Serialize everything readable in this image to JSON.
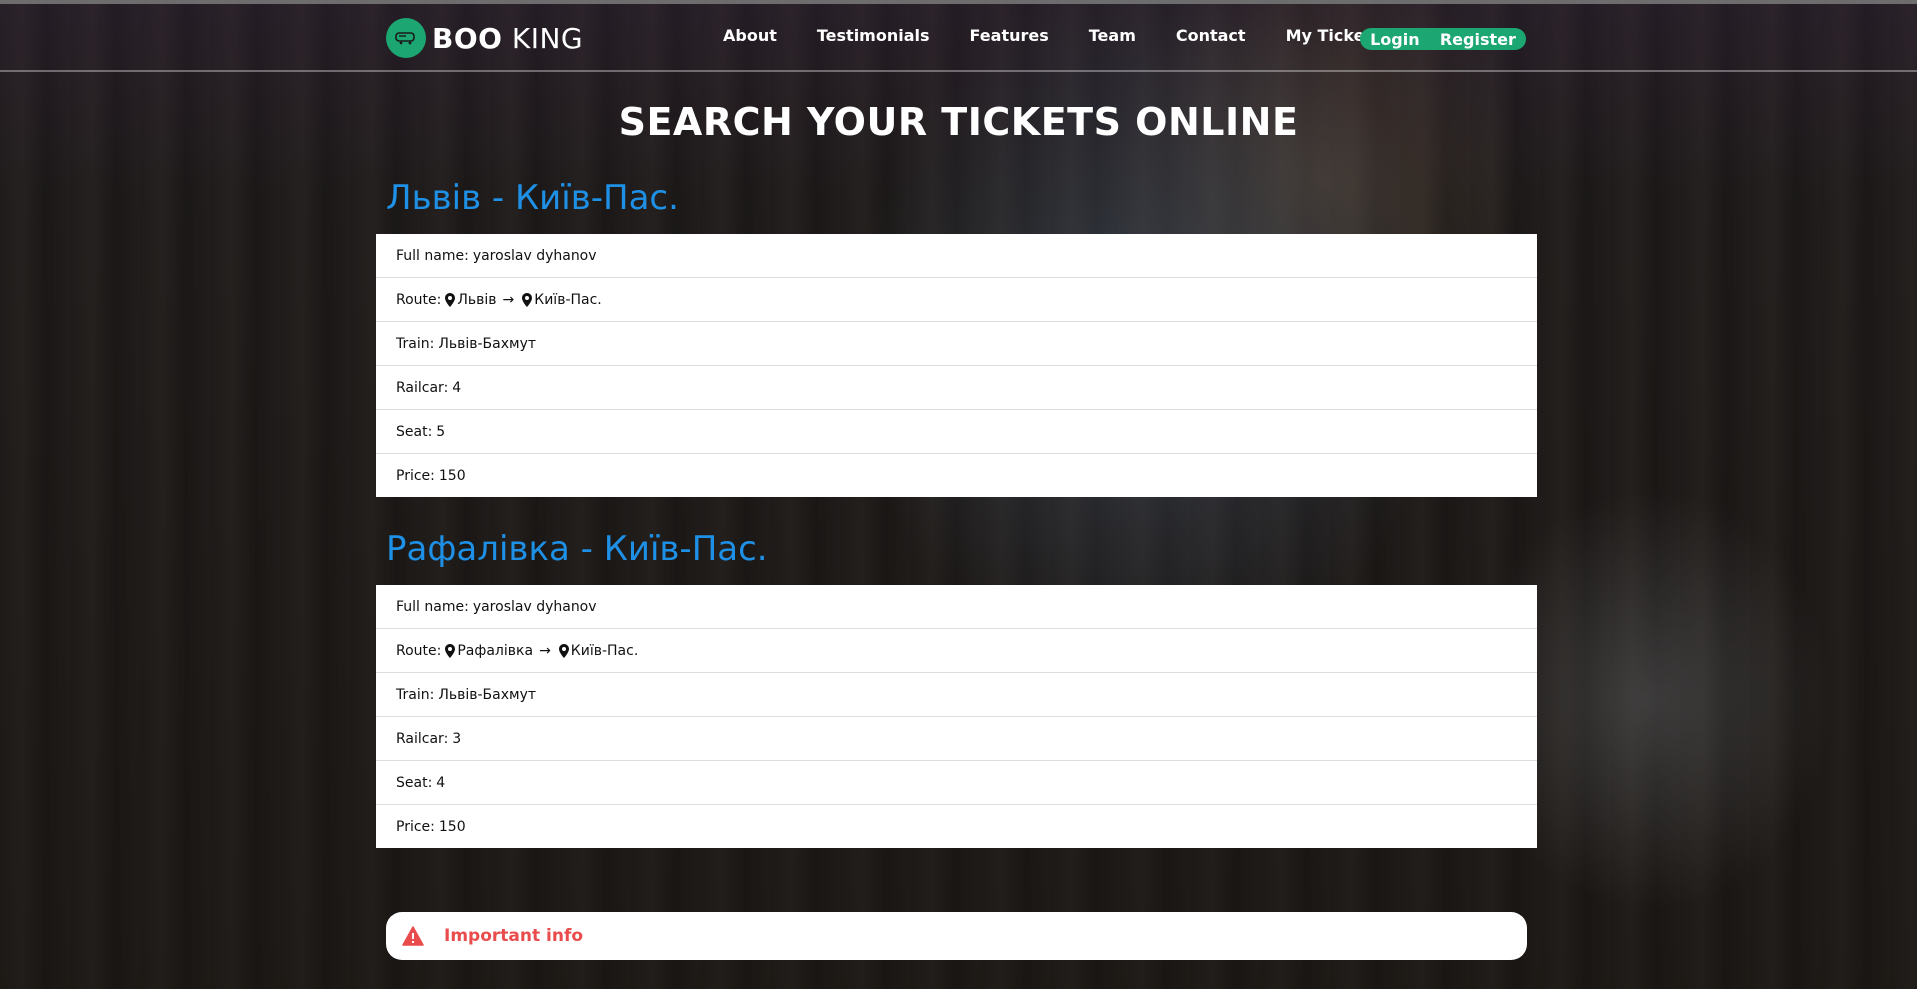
{
  "brand": {
    "bold": "BOO",
    "light": "KING",
    "accent": "#1ba672"
  },
  "nav": {
    "items": [
      "About",
      "Testimonials",
      "Features",
      "Team",
      "Contact",
      "My Tickets"
    ],
    "login": "Login",
    "register": "Register"
  },
  "page_title": "SEARCH YOUR TICKETS ONLINE",
  "tickets": [
    {
      "title": "Львів - Київ-Пас.",
      "full_name_label": "Full name:",
      "full_name": "yaroslav dyhanov",
      "route_label": "Route:",
      "route_from": "Львів",
      "route_to": "Київ-Пас.",
      "train_label": "Train:",
      "train": "Львів-Бахмут",
      "railcar_label": "Railcar:",
      "railcar": "4",
      "seat_label": "Seat:",
      "seat": "5",
      "price_label": "Price:",
      "price": "150"
    },
    {
      "title": "Рафалівка - Київ-Пас.",
      "full_name_label": "Full name:",
      "full_name": "yaroslav dyhanov",
      "route_label": "Route:",
      "route_from": "Рафалівка",
      "route_to": "Київ-Пас.",
      "train_label": "Train:",
      "train": "Львів-Бахмут",
      "railcar_label": "Railcar:",
      "railcar": "3",
      "seat_label": "Seat:",
      "seat": "4",
      "price_label": "Price:",
      "price": "150"
    }
  ],
  "info": {
    "label": "Important info",
    "color": "#e84c4c",
    "icon": "warning-icon"
  },
  "title_color": "#1e90e6"
}
